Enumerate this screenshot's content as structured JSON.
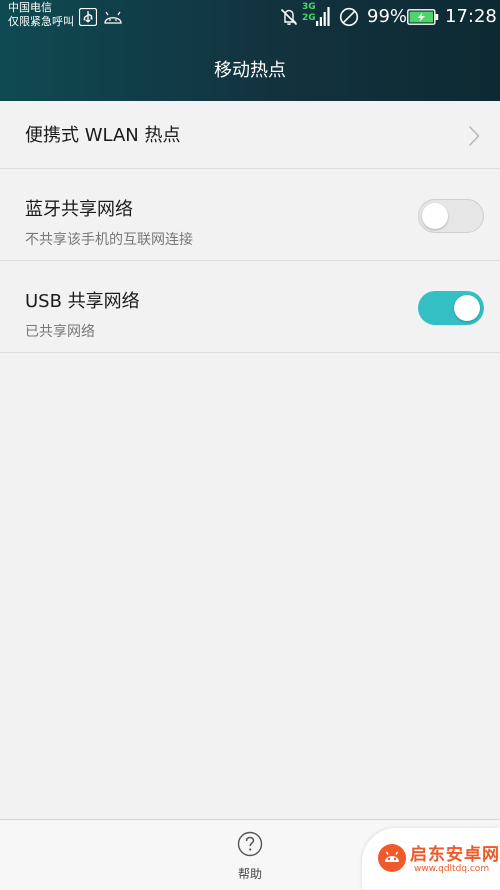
{
  "status_bar": {
    "carrier_line1": "中国电信",
    "carrier_line2": "仅限紧急呼叫",
    "network_3g": "3G",
    "network_2g": "2G",
    "battery": "99%",
    "time": "17:28"
  },
  "header": {
    "title": "移动热点"
  },
  "settings": {
    "items": [
      {
        "title": "便携式 WLAN 热点",
        "subtitle": "",
        "control": "chevron"
      },
      {
        "title": "蓝牙共享网络",
        "subtitle": "不共享该手机的互联网连接",
        "control": "switch",
        "on": false
      },
      {
        "title": "USB 共享网络",
        "subtitle": "已共享网络",
        "control": "switch",
        "on": true
      }
    ]
  },
  "bottom_bar": {
    "help_label": "帮助"
  },
  "watermark": {
    "name": "启东安卓网",
    "url": "www.qdltdq.com"
  },
  "colors": {
    "header_bg": "#12323e",
    "accent": "#33bfc3",
    "battery_green": "#4fd36b",
    "watermark_orange": "#f05a2a"
  }
}
